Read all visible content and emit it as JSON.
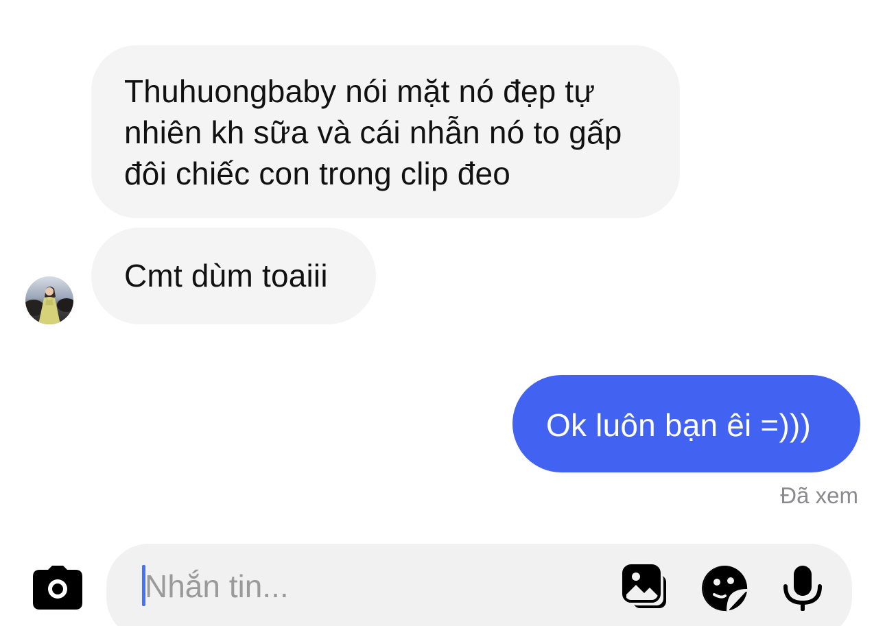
{
  "conversation": {
    "messages": [
      {
        "from": "them",
        "lines": [
          "Thuhuongbaby nói mặt nó đẹp tự",
          "nhiên kh sữa và cái nhẫn nó to gấp",
          "đôi chiếc con trong clip đeo"
        ]
      },
      {
        "from": "them",
        "text": "Cmt dùm toaiii"
      },
      {
        "from": "me",
        "text": "Ok luôn bạn êi =)))"
      }
    ],
    "read_receipt": "Đã xem"
  },
  "composer": {
    "placeholder": "Nhắn tin...",
    "value": ""
  },
  "icons": {
    "camera": "camera-icon",
    "gallery": "gallery-icon",
    "sticker": "sticker-icon",
    "mic": "microphone-icon"
  },
  "colors": {
    "outgoing_bubble": "#4263f2",
    "incoming_bubble": "#f4f4f4",
    "composer_bg": "#f1f1f1",
    "icon": "#000000",
    "receipt_text": "#8a8a8e"
  }
}
